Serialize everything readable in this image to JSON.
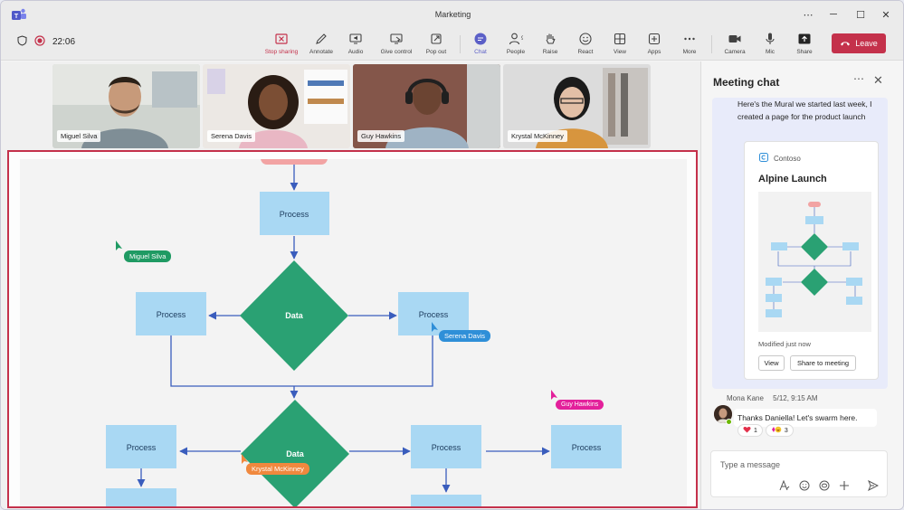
{
  "window": {
    "title": "Marketing"
  },
  "recording": {
    "time": "22:06"
  },
  "toolbar": {
    "stop_sharing": "Stop sharing",
    "annotate": "Annotate",
    "audio": "Audio",
    "give_control": "Give control",
    "pop_out": "Pop out",
    "chat": "Chat",
    "people": "People",
    "people_count": "9",
    "raise": "Raise",
    "react": "React",
    "view": "View",
    "apps": "Apps",
    "more": "More",
    "camera": "Camera",
    "mic": "Mic",
    "share": "Share",
    "leave": "Leave"
  },
  "participants": [
    {
      "name": "Miguel Silva"
    },
    {
      "name": "Serena Davis"
    },
    {
      "name": "Guy Hawkins"
    },
    {
      "name": "Krystal McKinney"
    }
  ],
  "diagram": {
    "process": "Process",
    "data": "Data"
  },
  "cursors": [
    {
      "name": "Miguel Silva",
      "color": "#1f9a63"
    },
    {
      "name": "Serena Davis",
      "color": "#2f8fd8"
    },
    {
      "name": "Guy Hawkins",
      "color": "#e3209b"
    },
    {
      "name": "Krystal McKinney",
      "color": "#f0883e"
    }
  ],
  "chat": {
    "title": "Meeting chat",
    "message": "Here's the Mural we started last week, I created a page for the product launch",
    "card": {
      "brand": "Contoso",
      "title": "Alpine Launch",
      "modified": "Modified just now",
      "view_button": "View",
      "share_button": "Share to meeting"
    },
    "reply": {
      "author": "Mona Kane",
      "timestamp": "5/12, 9:15 AM",
      "text": "Thanks Daniella! Let's swarm here.",
      "reactions": [
        {
          "icon": "heart-icon",
          "count": "1"
        },
        {
          "icon": "laugh-icon",
          "count": "3"
        }
      ]
    },
    "composer_placeholder": "Type a message"
  },
  "colors": {
    "accent": "#5b5fc7",
    "leave": "#c4314b",
    "process_fill": "#a9d8f3",
    "data_fill": "#2aa173",
    "connector": "#3a5dbd",
    "start_pill": "#f2a3a3"
  }
}
